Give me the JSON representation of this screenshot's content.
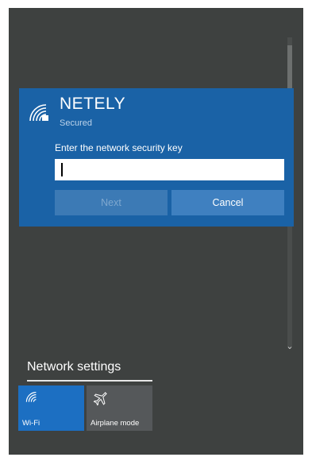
{
  "network": {
    "name": "NETELY",
    "status": "Secured",
    "key_prompt": "Enter the network security key",
    "key_value": "",
    "next_label": "Next",
    "cancel_label": "Cancel"
  },
  "network_settings_label": "Network settings",
  "quick_actions": [
    {
      "label": "Wi-Fi",
      "icon": "wifi-icon",
      "active": true
    },
    {
      "label": "Airplane mode",
      "icon": "airplane-icon",
      "active": false
    }
  ],
  "colors": {
    "flyout_bg": "#3e4140",
    "card_accent": "#1a62a6",
    "tile_active": "#1c6fc2",
    "tile_inactive": "#55585a"
  }
}
